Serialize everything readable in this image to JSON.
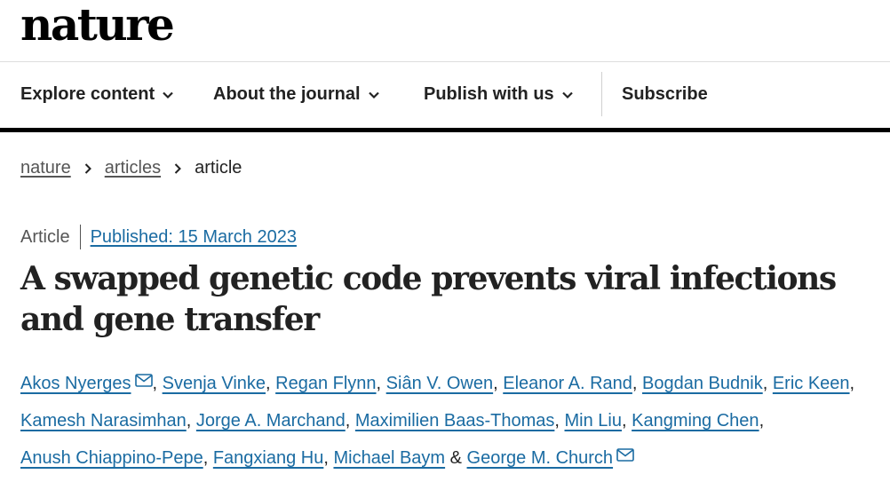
{
  "site": {
    "logo": "nature"
  },
  "nav": {
    "items": [
      {
        "label": "Explore content",
        "dropdown": true
      },
      {
        "label": "About the journal",
        "dropdown": true
      },
      {
        "label": "Publish with us",
        "dropdown": true
      },
      {
        "label": "Subscribe",
        "dropdown": false
      }
    ]
  },
  "breadcrumb": [
    "nature",
    "articles",
    "article"
  ],
  "article": {
    "type": "Article",
    "published": "Published: 15 March 2023",
    "title": "A swapped genetic code prevents viral infections and gene transfer",
    "authors": [
      {
        "name": "Akos Nyerges",
        "email_icon": true
      },
      {
        "name": "Svenja Vinke",
        "email_icon": false
      },
      {
        "name": "Regan Flynn",
        "email_icon": false
      },
      {
        "name": "Siân V. Owen",
        "email_icon": false
      },
      {
        "name": "Eleanor A. Rand",
        "email_icon": false
      },
      {
        "name": "Bogdan Budnik",
        "email_icon": false
      },
      {
        "name": "Eric Keen",
        "email_icon": false
      },
      {
        "name": "Kamesh Narasimhan",
        "email_icon": false
      },
      {
        "name": "Jorge A. Marchand",
        "email_icon": false
      },
      {
        "name": "Maximilien Baas-Thomas",
        "email_icon": false
      },
      {
        "name": "Min Liu",
        "email_icon": false
      },
      {
        "name": "Kangming Chen",
        "email_icon": false
      },
      {
        "name": "Anush Chiappino-Pepe",
        "email_icon": false
      },
      {
        "name": "Fangxiang Hu",
        "email_icon": false
      },
      {
        "name": "Michael Baym",
        "email_icon": false
      },
      {
        "name": "George M. Church",
        "email_icon": true
      }
    ],
    "last_separator": "&"
  },
  "colors": {
    "link": "#1a6ba2",
    "text": "#222222",
    "muted": "#555555",
    "rule": "#000000"
  }
}
